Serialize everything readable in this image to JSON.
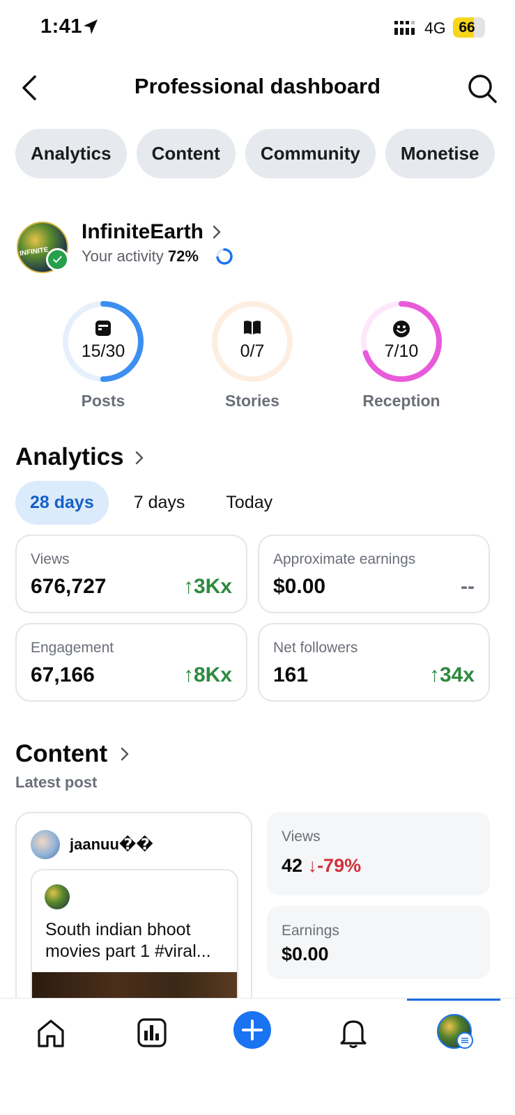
{
  "status_bar": {
    "time": "1:41",
    "network": "4G",
    "battery": "66",
    "battery_level": 0.66
  },
  "header": {
    "title": "Professional dashboard"
  },
  "chips": [
    "Analytics",
    "Content",
    "Community",
    "Monetise"
  ],
  "profile": {
    "name": "InfiniteEarth",
    "activity_label": "Your activity",
    "activity_value": "72%",
    "activity_fraction": 0.72,
    "avatar_text": "INFINITE"
  },
  "rings": [
    {
      "label": "Posts",
      "value": "15/30",
      "fraction": 0.5,
      "color": "#3d8ef0",
      "track": "#e6f0fd",
      "icon": "post-icon"
    },
    {
      "label": "Stories",
      "value": "0/7",
      "fraction": 0.0,
      "color": "#f5a25b",
      "track": "#fdeee2",
      "icon": "book-icon"
    },
    {
      "label": "Reception",
      "value": "7/10",
      "fraction": 0.7,
      "color": "#e85ad9",
      "track": "#fde8fb",
      "icon": "smile-icon"
    }
  ],
  "analytics": {
    "title": "Analytics",
    "tabs": [
      "28 days",
      "7 days",
      "Today"
    ],
    "active_tab": "28 days",
    "cards": [
      {
        "label": "Views",
        "value": "676,727",
        "change": "3Kx",
        "trend": "up"
      },
      {
        "label": "Approximate earnings",
        "value": "$0.00",
        "change": "--",
        "trend": "none"
      },
      {
        "label": "Engagement",
        "value": "67,166",
        "change": "8Kx",
        "trend": "up"
      },
      {
        "label": "Net followers",
        "value": "161",
        "change": "34x",
        "trend": "up"
      }
    ]
  },
  "content": {
    "title": "Content",
    "subtitle": "Latest post",
    "post": {
      "username": "jaanuu��",
      "caption_line1": "South indian bhoot",
      "caption_line2": "movies part 1 #viral..."
    },
    "stats": [
      {
        "label": "Views",
        "value": "42",
        "change": "-79%",
        "trend": "down"
      },
      {
        "label": "Earnings",
        "value": "$0.00"
      }
    ]
  },
  "nav": {
    "items": [
      "home-icon",
      "insights-icon",
      "create-icon",
      "notifications-icon",
      "profile-icon"
    ],
    "active": "profile-icon"
  },
  "colors": {
    "accent": "#1a73f0",
    "positive": "#2c8a3e",
    "negative": "#d0323c"
  }
}
